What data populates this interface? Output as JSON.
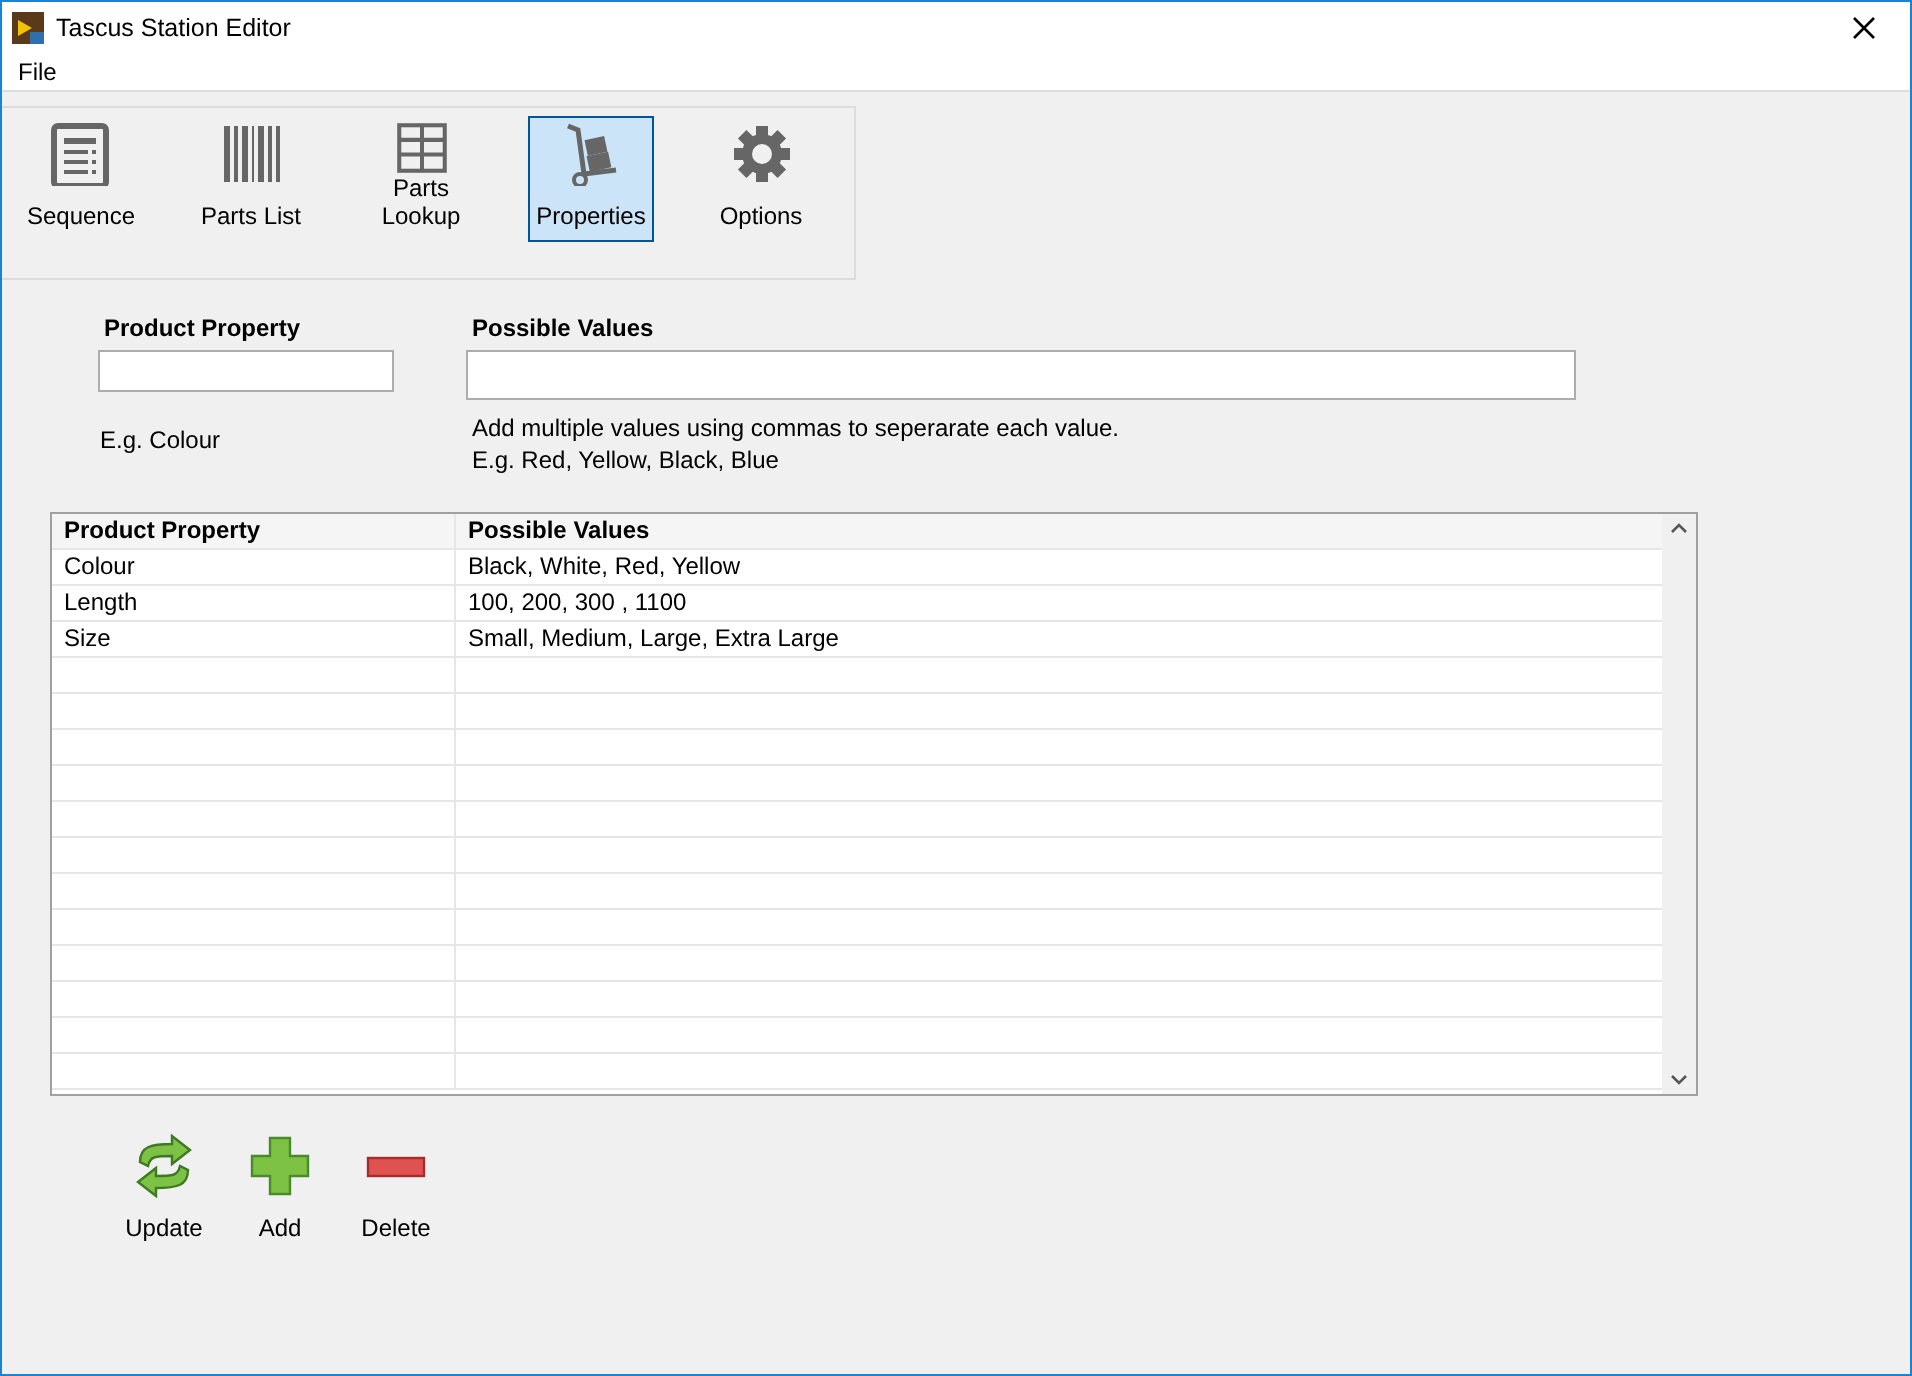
{
  "window": {
    "title": "Tascus Station Editor"
  },
  "menu": [
    "File"
  ],
  "toolbar": [
    {
      "label": "Sequence",
      "selected": false
    },
    {
      "label": "Parts List",
      "selected": false
    },
    {
      "label": "Parts Lookup",
      "selected": false
    },
    {
      "label": "Properties",
      "selected": true
    },
    {
      "label": "Options",
      "selected": false
    }
  ],
  "form": {
    "property_label": "Product Property",
    "property_hint": "E.g. Colour",
    "values_label": "Possible Values",
    "values_hint": [
      "Add multiple values using commas to seperarate each value.",
      "E.g. Red, Yellow, Black, Blue"
    ]
  },
  "table": {
    "columns": [
      "Product Property",
      "Possible Values"
    ],
    "rows": [
      [
        "Colour",
        "Black, White, Red, Yellow"
      ],
      [
        "Length",
        "100, 200, 300 , 1100"
      ],
      [
        "Size",
        "Small, Medium, Large, Extra Large"
      ]
    ]
  },
  "actions": [
    {
      "label": "Update"
    },
    {
      "label": "Add"
    },
    {
      "label": "Delete"
    }
  ]
}
